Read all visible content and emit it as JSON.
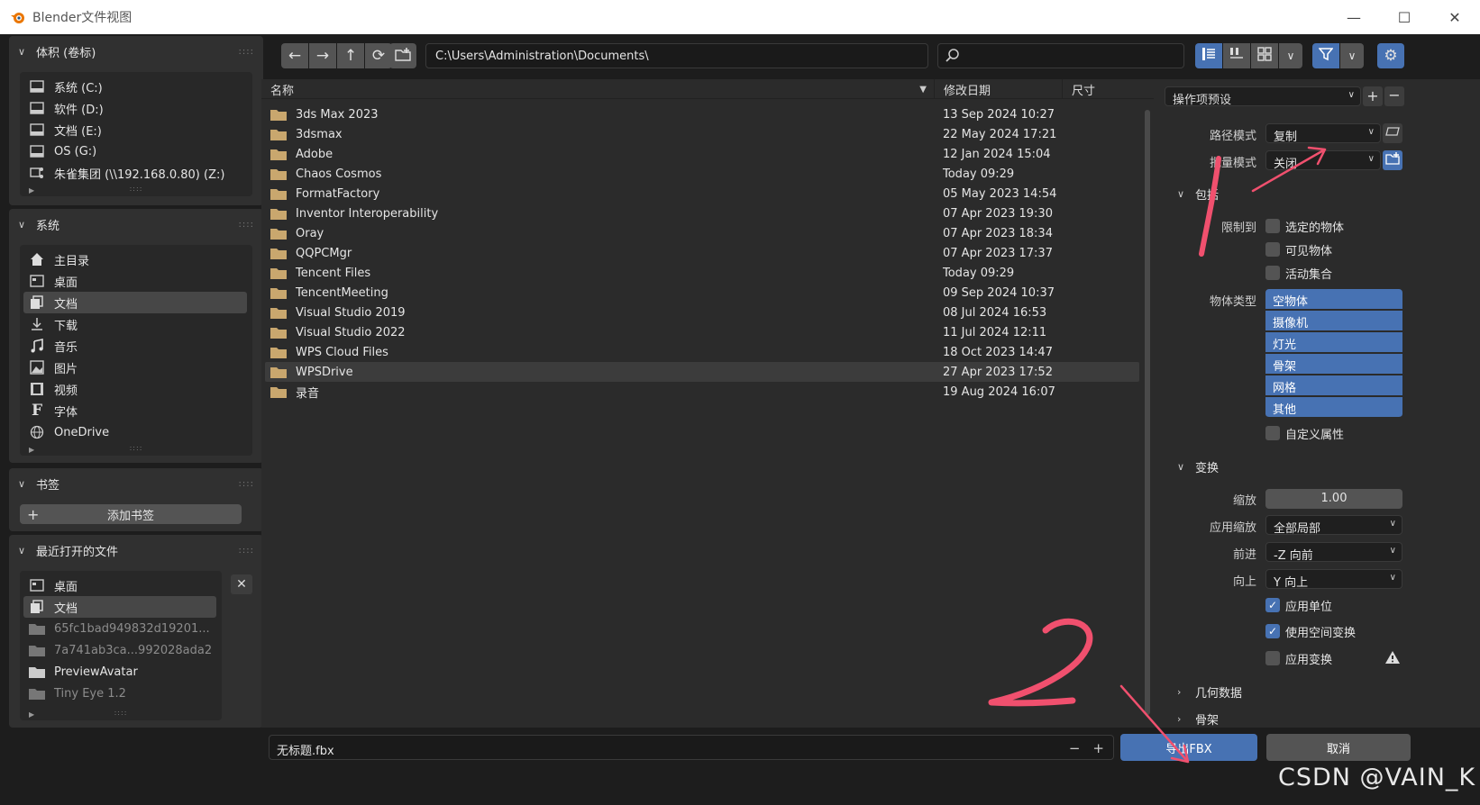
{
  "window": {
    "title": "Blender文件视图"
  },
  "sidebar": {
    "volumes": {
      "title": "体积 (卷标)",
      "items": [
        {
          "label": "系统 (C:)",
          "icon": "drive-icon"
        },
        {
          "label": "软件 (D:)",
          "icon": "drive-icon"
        },
        {
          "label": "文档 (E:)",
          "icon": "drive-icon"
        },
        {
          "label": "OS (G:)",
          "icon": "drive-icon"
        },
        {
          "label": "朱雀集团 (\\\\192.168.0.80) (Z:)",
          "icon": "network-drive-icon"
        }
      ]
    },
    "system": {
      "title": "系统",
      "items": [
        {
          "label": "主目录",
          "icon": "home-icon"
        },
        {
          "label": "桌面",
          "icon": "desktop-icon"
        },
        {
          "label": "文档",
          "icon": "documents-icon",
          "selected": true
        },
        {
          "label": "下载",
          "icon": "download-icon"
        },
        {
          "label": "音乐",
          "icon": "music-icon"
        },
        {
          "label": "图片",
          "icon": "image-icon"
        },
        {
          "label": "视频",
          "icon": "video-icon"
        },
        {
          "label": "字体",
          "icon": "font-icon"
        },
        {
          "label": "OneDrive",
          "icon": "globe-icon"
        }
      ]
    },
    "bookmarks": {
      "title": "书签",
      "add_label": "添加书签"
    },
    "recent": {
      "title": "最近打开的文件",
      "items": [
        {
          "label": "桌面",
          "icon": "desktop-icon"
        },
        {
          "label": "文档",
          "icon": "documents-icon",
          "selected": true
        },
        {
          "label": "65fc1bad949832d19201...",
          "icon": "folder-icon",
          "dim": true
        },
        {
          "label": "7a741ab3ca...992028ada2",
          "icon": "folder-icon",
          "dim": true
        },
        {
          "label": "PreviewAvatar",
          "icon": "folder-icon"
        },
        {
          "label": "Tiny Eye 1.2",
          "icon": "folder-icon",
          "dim": true
        }
      ]
    }
  },
  "toolbar": {
    "path": "C:\\Users\\Administration\\Documents\\",
    "search_placeholder": ""
  },
  "filelist": {
    "columns": {
      "name": "名称",
      "date": "修改日期",
      "size": "尺寸"
    },
    "rows": [
      {
        "name": "3ds Max 2023",
        "date": "13 Sep 2024 10:27"
      },
      {
        "name": "3dsmax",
        "date": "22 May 2024 17:21"
      },
      {
        "name": "Adobe",
        "date": "12 Jan 2024 15:04"
      },
      {
        "name": "Chaos Cosmos",
        "date": "Today 09:29"
      },
      {
        "name": "FormatFactory",
        "date": "05 May 2023 14:54"
      },
      {
        "name": "Inventor Interoperability",
        "date": "07 Apr 2023 19:30"
      },
      {
        "name": "Oray",
        "date": "07 Apr 2023 18:34"
      },
      {
        "name": "QQPCMgr",
        "date": "07 Apr 2023 17:37"
      },
      {
        "name": "Tencent Files",
        "date": "Today 09:29"
      },
      {
        "name": "TencentMeeting",
        "date": "09 Sep 2024 10:37"
      },
      {
        "name": "Visual Studio 2019",
        "date": "08 Jul 2024 16:53"
      },
      {
        "name": "Visual Studio 2022",
        "date": "11 Jul 2024 12:11"
      },
      {
        "name": "WPS Cloud Files",
        "date": "18 Oct 2023 14:47"
      },
      {
        "name": "WPSDrive",
        "date": "27 Apr 2023 17:52",
        "selected": true
      },
      {
        "name": "录音",
        "date": "19 Aug 2024 16:07"
      }
    ]
  },
  "bottom": {
    "filename": "无标题.fbx",
    "export_label": "导出FBX",
    "cancel_label": "取消"
  },
  "options": {
    "preset_label": "操作项预设",
    "path_mode": {
      "label": "路径模式",
      "value": "复制"
    },
    "batch_mode": {
      "label": "批量模式",
      "value": "关闭"
    },
    "include": {
      "title": "包括",
      "limit_label": "限制到",
      "limits": [
        "选定的物体",
        "可见物体",
        "活动集合"
      ],
      "objtype_label": "物体类型",
      "objtypes": [
        "空物体",
        "摄像机",
        "灯光",
        "骨架",
        "网格",
        "其他"
      ],
      "custom_props": "自定义属性"
    },
    "transform": {
      "title": "变换",
      "scale_label": "缩放",
      "scale_value": "1.00",
      "apply_scale_label": "应用缩放",
      "apply_scale_value": "全部局部",
      "forward_label": "前进",
      "forward_value": "-Z 向前",
      "up_label": "向上",
      "up_value": "Y 向上",
      "apply_unit": "应用单位",
      "use_space": "使用空间变换",
      "apply_transform": "应用变换"
    },
    "geometry_title": "几何数据",
    "armature_title": "骨架"
  },
  "watermark": "CSDN @VAIN_K",
  "colors": {
    "accent": "#4772b3",
    "annotation": "#f0506e"
  }
}
